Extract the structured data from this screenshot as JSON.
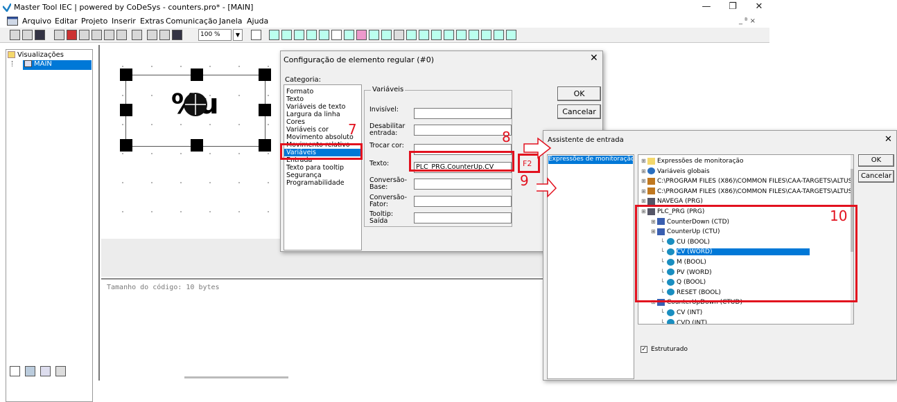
{
  "window": {
    "title": "Master Tool IEC | powered by CoDeSys - counters.pro* - [MAIN]",
    "minimize": "—",
    "restore": "❐",
    "close": "✕",
    "mdi_controls": "_ ᴮ ×"
  },
  "menu": [
    "Arquivo",
    "Editar",
    "Projeto",
    "Inserir",
    "Extras",
    "Comunicação",
    "Janela",
    "Ajuda"
  ],
  "toolbar": {
    "zoom": "100 %"
  },
  "left_tree": {
    "root": "Visualizações",
    "child": "MAIN"
  },
  "canvas": {
    "element_text": "%u"
  },
  "messages": {
    "text": "Tamanho do código: 10 bytes"
  },
  "config_dialog": {
    "title": "Configuração de elemento regular (#0)",
    "category_label": "Categoria:",
    "categories": [
      "Formato",
      "Texto",
      "Variáveis de texto",
      "Largura da linha",
      "Cores",
      "Variáveis cor",
      "Movimento absoluto",
      "Movimento relativo",
      "Variáveis",
      "Entrada",
      "Texto para tooltip",
      "Segurança",
      "Programabilidade"
    ],
    "selected_category": "Variáveis",
    "group_label": "Variáveis",
    "fields": [
      {
        "label": "Invisível:",
        "value": ""
      },
      {
        "label": "Desabilitar entrada:",
        "value": ""
      },
      {
        "label": "Trocar cor:",
        "value": ""
      },
      {
        "label": "Texto:",
        "value": "PLC_PRG.CounterUp.CV"
      },
      {
        "label": "Conversão-Base:",
        "value": ""
      },
      {
        "label": "Conversão-Fator:",
        "value": ""
      },
      {
        "label": "Tooltip: Saída",
        "value": ""
      }
    ],
    "ok": "OK",
    "cancel": "Cancelar"
  },
  "input_dialog": {
    "title": "Assistente de entrada",
    "left_item": "Expressões de monitoração",
    "tree": [
      {
        "text": "Expressões de monitoração",
        "level": 0,
        "icon": "folder"
      },
      {
        "text": "Variáveis globais",
        "level": 0,
        "icon": "globe"
      },
      {
        "text": "C:\\PROGRAM FILES (X86)\\COMMON FILES\\CAA-TARGETS\\ALTUS\\DI",
        "level": 0,
        "icon": "library"
      },
      {
        "text": "C:\\PROGRAM FILES (X86)\\COMMON FILES\\CAA-TARGETS\\ALTUS\\DI",
        "level": 0,
        "icon": "library"
      },
      {
        "text": "NAVEGA (PRG)",
        "level": 0,
        "icon": "program"
      },
      {
        "text": "PLC_PRG (PRG)",
        "level": 0,
        "icon": "program"
      },
      {
        "text": "CounterDown (CTD)",
        "level": 1,
        "icon": "fb"
      },
      {
        "text": "CounterUp (CTU)",
        "level": 1,
        "icon": "fb"
      },
      {
        "text": "CU (BOOL)",
        "level": 2,
        "icon": "var"
      },
      {
        "text": "CV (WORD)",
        "level": 2,
        "icon": "var",
        "selected": true
      },
      {
        "text": "M (BOOL)",
        "level": 2,
        "icon": "var"
      },
      {
        "text": "PV (WORD)",
        "level": 2,
        "icon": "var"
      },
      {
        "text": "Q (BOOL)",
        "level": 2,
        "icon": "var"
      },
      {
        "text": "RESET (BOOL)",
        "level": 2,
        "icon": "var"
      },
      {
        "text": "CounterUpDown (CTUD)",
        "level": 1,
        "icon": "fb"
      },
      {
        "text": "CV (INT)",
        "level": 2,
        "icon": "var"
      },
      {
        "text": "CVD (INT)",
        "level": 2,
        "icon": "var"
      }
    ],
    "structured_label": "Estruturado",
    "ok": "OK",
    "cancel": "Cancelar"
  },
  "annotations": {
    "n7": "7",
    "n8": "8",
    "n9": "9",
    "n10": "10",
    "f2": "F2"
  },
  "colors": {
    "accent": "#0078d7",
    "annotation_red": "#e2111e"
  }
}
